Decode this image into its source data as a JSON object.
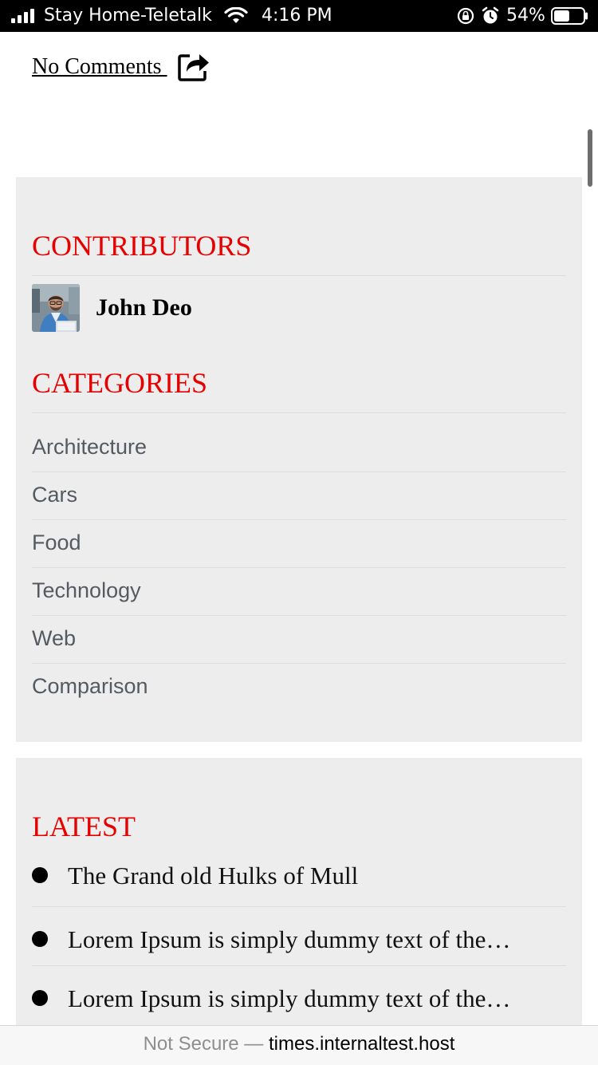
{
  "status_bar": {
    "carrier": "Stay Home-Teletalk",
    "time": "4:16 PM",
    "battery_percent": "54%",
    "battery_level": 0.54,
    "icons": [
      "signal-icon",
      "wifi-icon",
      "orientation-lock-icon",
      "alarm-icon",
      "battery-icon"
    ]
  },
  "post_meta": {
    "comments_label": "No Comments ",
    "share_icon": "share-icon"
  },
  "sidebar": {
    "contributors": {
      "title": "CONTRIBUTORS",
      "items": [
        {
          "name": "John Deo",
          "avatar_icon": "avatar"
        }
      ]
    },
    "categories": {
      "title": "CATEGORIES",
      "items": [
        "Architecture",
        "Cars",
        "Food",
        "Technology",
        "Web",
        "Comparison"
      ]
    },
    "latest": {
      "title": "LATEST",
      "items": [
        "The Grand old Hulks of Mull",
        "Lorem Ipsum is simply dummy text of the…",
        "Lorem Ipsum is simply dummy text of the…"
      ]
    }
  },
  "browser": {
    "security_label": "Not Secure —",
    "domain": "times.internaltest.host"
  },
  "colors": {
    "accent_red": "#e60000",
    "panel_bg": "#ededed",
    "category_text": "#555a60"
  }
}
